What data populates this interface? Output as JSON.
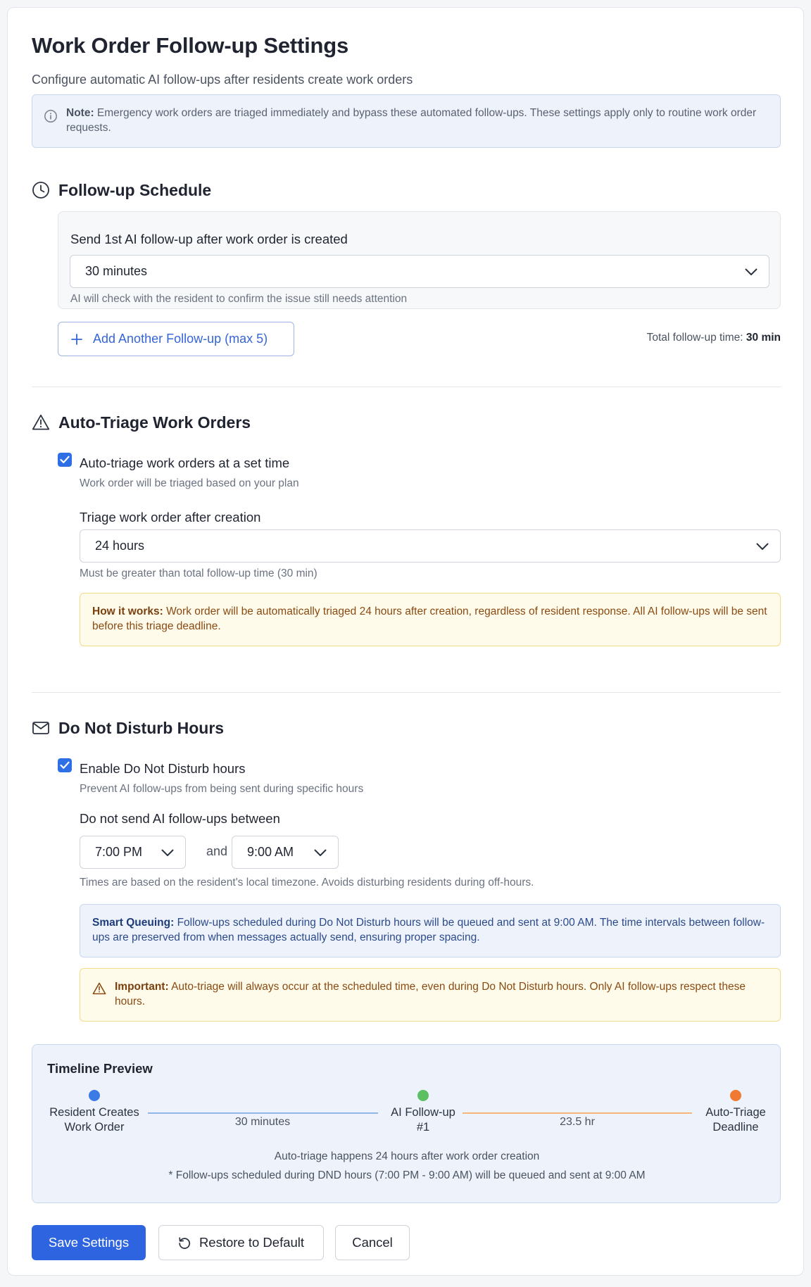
{
  "header": {
    "title": "Work Order Follow-up Settings",
    "subtitle": "Configure automatic AI follow-ups after residents create work orders"
  },
  "note": {
    "icon": "info-icon",
    "bold": "Note:",
    "text": " Emergency work orders are triaged immediately and bypass these automated follow-ups. These settings apply only to routine work order requests."
  },
  "schedule": {
    "title": "Follow-up Schedule",
    "icon": "clock-icon",
    "followup_label": "Send 1st AI follow-up after work order is created",
    "followup_value": "30 minutes",
    "followup_hint": "AI will check with the resident to confirm the issue still needs attention",
    "add_button": "Add Another Follow-up (max 5)",
    "total_label": "Total follow-up time: ",
    "total_value": "30 min"
  },
  "triage": {
    "title": "Auto-Triage Work Orders",
    "icon": "warning-triangle-icon",
    "checkbox_label": "Auto-triage work orders at a set time",
    "checkbox_checked": true,
    "checkbox_hint": "Work order will be triaged based on your plan",
    "field_label": "Triage work order after creation",
    "field_value": "24 hours",
    "field_hint": "Must be greater than total follow-up time (30 min)",
    "how_bold": "How it works:",
    "how_text": " Work order will be automatically triaged 24 hours after creation, regardless of resident response. All AI follow-ups will be sent before this triage deadline."
  },
  "dnd": {
    "title": "Do Not Disturb Hours",
    "icon": "mail-icon",
    "checkbox_label": "Enable Do Not Disturb hours",
    "checkbox_checked": true,
    "checkbox_hint": "Prevent AI follow-ups from being sent during specific hours",
    "range_label": "Do not send AI follow-ups between",
    "start_value": "7:00 PM",
    "and_text": "and",
    "end_value": "9:00 AM",
    "range_hint": "Times are based on the resident's local timezone. Avoids disturbing residents during off-hours.",
    "smart_bold": "Smart Queuing:",
    "smart_text": " Follow-ups scheduled during Do Not Disturb hours will be queued and sent at 9:00 AM. The time intervals between follow-ups are preserved from when messages actually send, ensuring proper spacing.",
    "important_bold": "Important:",
    "important_text": " Auto-triage will always occur at the scheduled time, even during Do Not Disturb hours. Only AI follow-ups respect these hours."
  },
  "timeline": {
    "title": "Timeline Preview",
    "nodes": [
      {
        "line1": "Resident Creates",
        "line2": "Work Order",
        "color": "#3b7be6"
      },
      {
        "line1": "AI Follow-up",
        "line2": "#1",
        "color": "#5cc063"
      },
      {
        "line1": "Auto-Triage",
        "line2": "Deadline",
        "color": "#f07a32"
      }
    ],
    "segments": [
      {
        "label": "30 minutes",
        "color": "#8fb6e6"
      },
      {
        "label": "23.5 hr",
        "color": "#f5b678"
      }
    ],
    "footer1": "Auto-triage happens 24 hours after work order creation",
    "footer2": "* Follow-ups scheduled during DND hours (7:00 PM - 9:00 AM) will be queued and sent at 9:00 AM"
  },
  "actions": {
    "save": "Save Settings",
    "restore": "Restore to Default",
    "cancel": "Cancel"
  },
  "colors": {
    "accent": "#2f64e0",
    "checkbox": "#2f6fe6",
    "info_bg": "#eef3fb",
    "warn_bg": "#fffbea"
  }
}
